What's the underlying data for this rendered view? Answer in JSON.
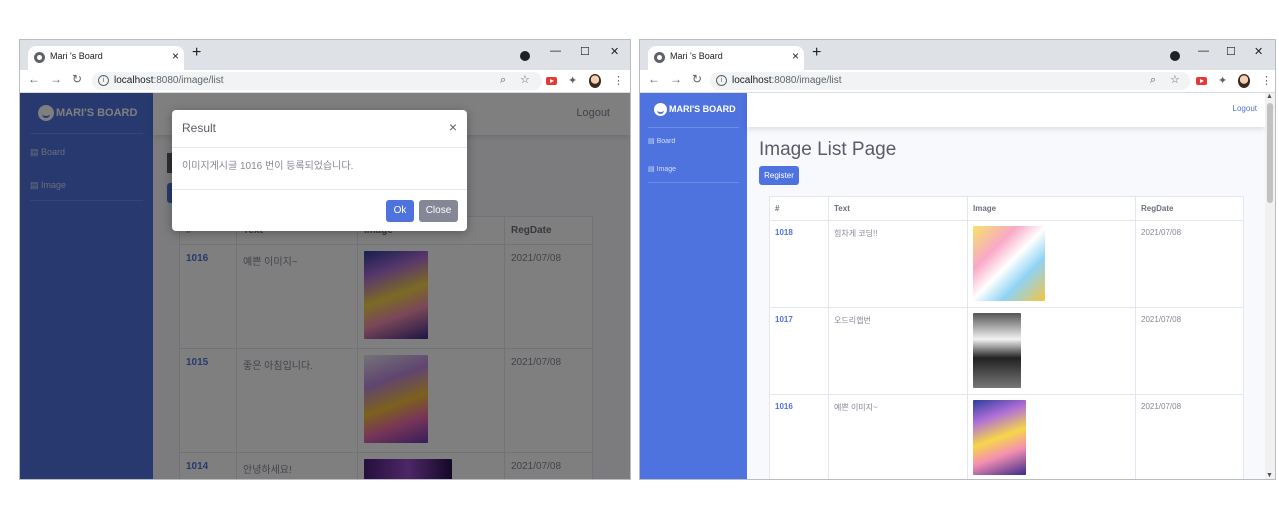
{
  "left": {
    "tab_title": "Mari 's Board",
    "url_host": "localhost",
    "url_rest": ":8080/image/list",
    "brand": "MARI'S BOARD",
    "sidebar": [
      "Board",
      "Image"
    ],
    "logout": "Logout",
    "table": {
      "headers": [
        "#",
        "Text",
        "Image",
        "RegDate"
      ],
      "rows": [
        {
          "id": "1016",
          "text": "예쁜 이미지~",
          "date": "2021/07/08"
        },
        {
          "id": "1015",
          "text": "좋은 아침입니다.",
          "date": "2021/07/08"
        },
        {
          "id": "1014",
          "text": "안녕하세요!",
          "date": "2021/07/08"
        }
      ]
    },
    "modal": {
      "title": "Result",
      "message": "이미지게시글 1016 번이 등록되었습니다.",
      "ok": "Ok",
      "close": "Close",
      "close_icon": "×"
    }
  },
  "right": {
    "tab_title": "Mari 's Board",
    "url_host": "localhost",
    "url_rest": ":8080/image/list",
    "brand": "MARI'S BOARD",
    "sidebar": [
      "Board",
      "Image"
    ],
    "logout": "Logout",
    "page_title": "Image List Page",
    "register": "Register",
    "table": {
      "headers": [
        "#",
        "Text",
        "Image",
        "RegDate"
      ],
      "rows": [
        {
          "id": "1018",
          "text": "힘차게 코딩!!",
          "date": "2021/07/08"
        },
        {
          "id": "1017",
          "text": "오드리햅번",
          "date": "2021/07/08"
        },
        {
          "id": "1016",
          "text": "예쁜 이미지~",
          "date": "2021/07/08"
        }
      ]
    }
  },
  "colors": {
    "primary": "#4e73df",
    "chrome": "#dee1e6",
    "secondary_btn": "#858796"
  }
}
